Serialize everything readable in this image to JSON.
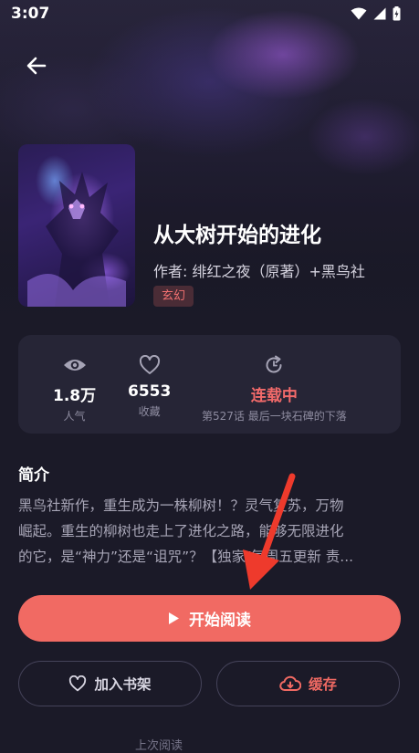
{
  "status_bar": {
    "time": "3:07"
  },
  "book": {
    "title": "从大树开始的进化",
    "author": "作者: 绯红之夜（原著）+黑鸟社",
    "genre": "玄幻"
  },
  "stats": {
    "views_value": "1.8万",
    "views_label": "人气",
    "favorites_value": "6553",
    "favorites_label": "收藏",
    "status_value": "连载中",
    "status_detail": "第527话 最后一块石碑的下落"
  },
  "intro": {
    "heading": "简介",
    "lines": [
      "黑鸟社新作，重生成为一株柳树！？灵气复苏，万物",
      "崛起。重生的柳树也走上了进化之路，能够无限进化",
      "的它，是“神力”还是“诅咒”？【独家/每周五更新 责..."
    ]
  },
  "actions": {
    "read_label": "开始阅读",
    "shelf_label": "加入书架",
    "cache_label": "缓存"
  },
  "bottom_hint": "上次阅读",
  "colors": {
    "accent": "#f16a63",
    "status_red": "#f26a6a",
    "card_bg": "#262536",
    "page_bg": "#1b1a28"
  },
  "icons": [
    "back-arrow-icon",
    "wifi-icon",
    "signal-icon",
    "battery-icon",
    "eye-icon",
    "heart-icon",
    "refresh-icon",
    "play-icon",
    "cloud-download-icon"
  ]
}
